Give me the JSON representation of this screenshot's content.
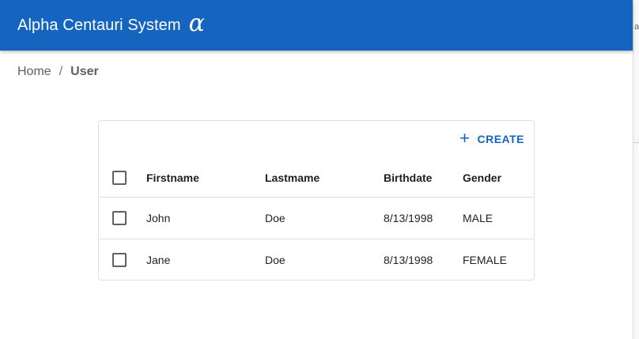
{
  "app": {
    "title": "Alpha Centauri System",
    "logo_glyph": "α"
  },
  "breadcrumb": {
    "home": "Home",
    "separator": "/",
    "current": "User"
  },
  "table": {
    "create_label": "CREATE",
    "columns": [
      "Firstname",
      "Lastmame",
      "Birthdate",
      "Gender"
    ],
    "rows": [
      {
        "firstname": "John",
        "lastname": "Doe",
        "birthdate": "8/13/1998",
        "gender": "MALE"
      },
      {
        "firstname": "Jane",
        "lastname": "Doe",
        "birthdate": "8/13/1998",
        "gender": "FEMALE"
      }
    ]
  },
  "edge": {
    "glyph": "a"
  },
  "colors": {
    "appbar": "#1565c0",
    "accent": "#1565c0"
  }
}
